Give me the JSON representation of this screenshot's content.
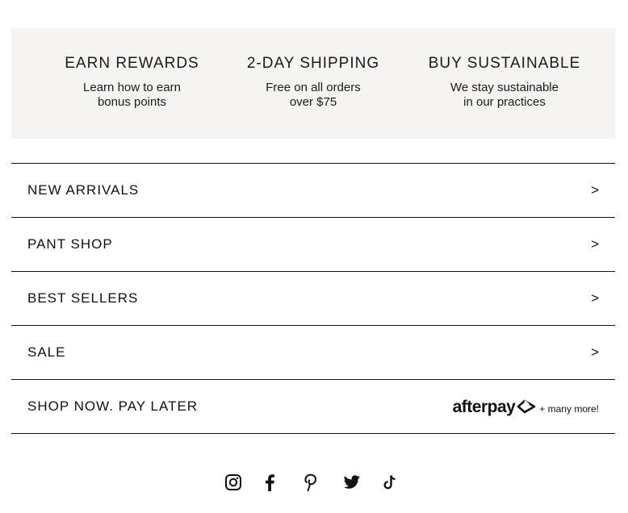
{
  "benefits": [
    {
      "title": "EARN REWARDS",
      "line1": "Learn how to earn",
      "line2": "bonus points"
    },
    {
      "title": "2-DAY SHIPPING",
      "line1": "Free on all orders",
      "line2": "over $75"
    },
    {
      "title": "BUY SUSTAINABLE",
      "line1": "We stay sustainable",
      "line2": "in our practices"
    }
  ],
  "nav": {
    "arrow": ">",
    "items": [
      {
        "label": "NEW ARRIVALS"
      },
      {
        "label": "PANT SHOP"
      },
      {
        "label": "BEST SELLERS"
      },
      {
        "label": "SALE"
      },
      {
        "label": "SHOP NOW. PAY LATER"
      }
    ]
  },
  "afterpay": {
    "logo_text": "afterpay",
    "more_text": "+ many more!"
  },
  "social": {
    "icons": [
      "instagram-icon",
      "facebook-icon",
      "pinterest-icon",
      "twitter-icon",
      "tiktok-icon"
    ]
  }
}
